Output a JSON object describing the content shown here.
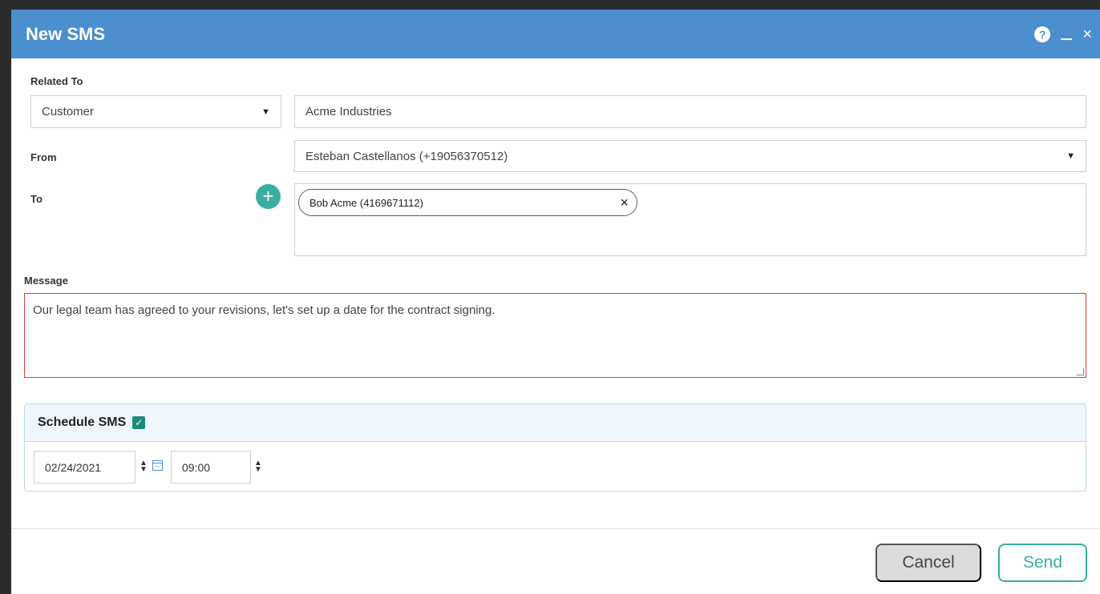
{
  "dialog": {
    "title": "New SMS",
    "help_glyph": "?",
    "close_glyph": "×"
  },
  "related_to": {
    "label": "Related To",
    "type_value": "Customer",
    "entity_value": "Acme Industries"
  },
  "from": {
    "label": "From",
    "value": "Esteban Castellanos (+19056370512)"
  },
  "to": {
    "label": "To",
    "add_glyph": "+",
    "recipients": [
      {
        "label": "Bob Acme (4169671112)",
        "remove_glyph": "×"
      }
    ]
  },
  "message": {
    "label": "Message",
    "value": "Our legal team has agreed to your revisions, let's set up a date for the contract signing."
  },
  "schedule": {
    "label": "Schedule SMS",
    "checked": true,
    "check_glyph": "✓",
    "date": "02/24/2021",
    "time": "09:00"
  },
  "footer": {
    "cancel_label": "Cancel",
    "send_label": "Send"
  },
  "icons": {
    "dropdown": "caret-down-icon",
    "spinner": "up-down-spinner-icon",
    "calendar": "calendar-icon"
  },
  "colors": {
    "titlebar": "#4b8fcf",
    "accent": "#3aafa1",
    "error_border": "#e03a3a",
    "schedule_border": "#b7dbe8"
  }
}
